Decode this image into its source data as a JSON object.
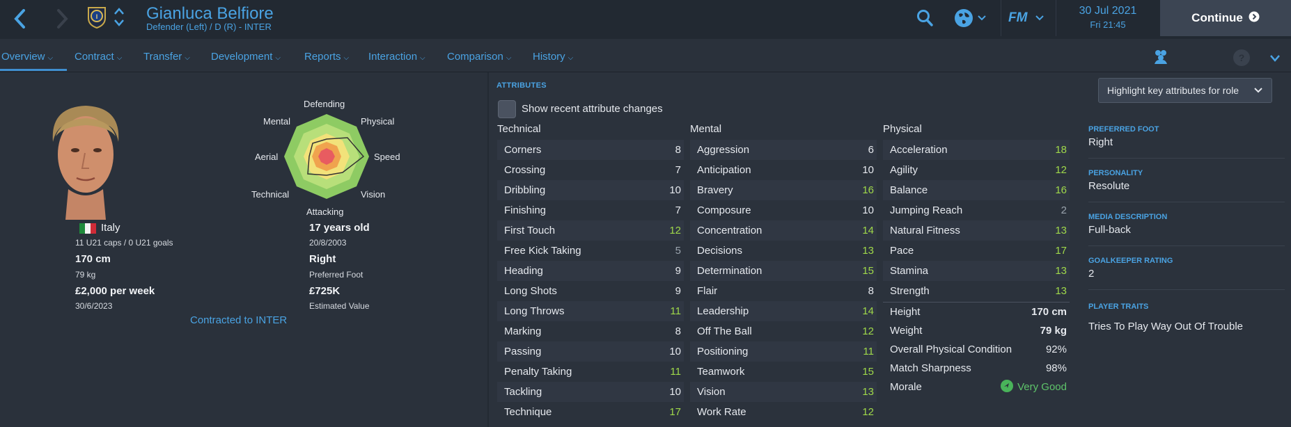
{
  "header": {
    "player_name": "Gianluca Belfiore",
    "player_subtitle": "Defender (Left) / D (R) - INTER",
    "date": "30 Jul 2021",
    "time": "Fri 21:45",
    "continue_label": "Continue",
    "logo_label": "FM"
  },
  "tabs": [
    {
      "label": "Overview"
    },
    {
      "label": "Contract"
    },
    {
      "label": "Transfer"
    },
    {
      "label": "Development"
    },
    {
      "label": "Reports"
    },
    {
      "label": "Interaction"
    },
    {
      "label": "Comparison"
    },
    {
      "label": "History"
    }
  ],
  "profile": {
    "nationality": "Italy",
    "caps": "11 U21 caps / 0 U21 goals",
    "height": "170 cm",
    "weight": "79 kg",
    "wage": "£2,000 per week",
    "contract_end": "30/6/2023",
    "contracted_to": "Contracted to INTER",
    "age": "17 years old",
    "dob": "20/8/2003",
    "preferred_foot": "Right",
    "preferred_foot_label": "Preferred Foot",
    "value": "£725K",
    "value_label": "Estimated Value"
  },
  "radar": {
    "labels": {
      "defending": "Defending",
      "physical": "Physical",
      "speed": "Speed",
      "vision": "Vision",
      "attacking": "Attacking",
      "technical": "Technical",
      "aerial": "Aerial",
      "mental": "Mental"
    }
  },
  "attributes": {
    "title": "ATTRIBUTES",
    "show_changes": "Show recent attribute changes",
    "highlight_label": "Highlight key attributes for role",
    "technical_title": "Technical",
    "mental_title": "Mental",
    "physical_title": "Physical",
    "technical": [
      {
        "name": "Corners",
        "value": "8",
        "tone": "white"
      },
      {
        "name": "Crossing",
        "value": "7",
        "tone": "white"
      },
      {
        "name": "Dribbling",
        "value": "10",
        "tone": "white"
      },
      {
        "name": "Finishing",
        "value": "7",
        "tone": "white"
      },
      {
        "name": "First Touch",
        "value": "12",
        "tone": "green"
      },
      {
        "name": "Free Kick Taking",
        "value": "5",
        "tone": "grey"
      },
      {
        "name": "Heading",
        "value": "9",
        "tone": "white"
      },
      {
        "name": "Long Shots",
        "value": "9",
        "tone": "white"
      },
      {
        "name": "Long Throws",
        "value": "11",
        "tone": "green"
      },
      {
        "name": "Marking",
        "value": "8",
        "tone": "white"
      },
      {
        "name": "Passing",
        "value": "10",
        "tone": "white"
      },
      {
        "name": "Penalty Taking",
        "value": "11",
        "tone": "green"
      },
      {
        "name": "Tackling",
        "value": "10",
        "tone": "white"
      },
      {
        "name": "Technique",
        "value": "17",
        "tone": "green"
      }
    ],
    "mental": [
      {
        "name": "Aggression",
        "value": "6",
        "tone": "white"
      },
      {
        "name": "Anticipation",
        "value": "10",
        "tone": "white"
      },
      {
        "name": "Bravery",
        "value": "16",
        "tone": "green"
      },
      {
        "name": "Composure",
        "value": "10",
        "tone": "white"
      },
      {
        "name": "Concentration",
        "value": "14",
        "tone": "green"
      },
      {
        "name": "Decisions",
        "value": "13",
        "tone": "green"
      },
      {
        "name": "Determination",
        "value": "15",
        "tone": "green"
      },
      {
        "name": "Flair",
        "value": "8",
        "tone": "white"
      },
      {
        "name": "Leadership",
        "value": "14",
        "tone": "green"
      },
      {
        "name": "Off The Ball",
        "value": "12",
        "tone": "green"
      },
      {
        "name": "Positioning",
        "value": "11",
        "tone": "green"
      },
      {
        "name": "Teamwork",
        "value": "15",
        "tone": "green"
      },
      {
        "name": "Vision",
        "value": "13",
        "tone": "green"
      },
      {
        "name": "Work Rate",
        "value": "12",
        "tone": "green"
      }
    ],
    "physical": [
      {
        "name": "Acceleration",
        "value": "18",
        "tone": "green"
      },
      {
        "name": "Agility",
        "value": "12",
        "tone": "green"
      },
      {
        "name": "Balance",
        "value": "16",
        "tone": "green"
      },
      {
        "name": "Jumping Reach",
        "value": "2",
        "tone": "grey"
      },
      {
        "name": "Natural Fitness",
        "value": "13",
        "tone": "green"
      },
      {
        "name": "Pace",
        "value": "17",
        "tone": "green"
      },
      {
        "name": "Stamina",
        "value": "13",
        "tone": "green"
      },
      {
        "name": "Strength",
        "value": "13",
        "tone": "green"
      }
    ],
    "physical_extra": [
      {
        "name": "Height",
        "value": "170 cm"
      },
      {
        "name": "Weight",
        "value": "79 kg"
      },
      {
        "name": "Overall Physical Condition",
        "value": "92%"
      },
      {
        "name": "Match Sharpness",
        "value": "98%"
      },
      {
        "name": "Morale",
        "value": "Very Good"
      }
    ]
  },
  "side_info": {
    "preferred_foot_label": "PREFERRED FOOT",
    "preferred_foot": "Right",
    "personality_label": "PERSONALITY",
    "personality": "Resolute",
    "media_label": "MEDIA DESCRIPTION",
    "media": "Full-back",
    "gk_label": "GOALKEEPER RATING",
    "gk": "2",
    "traits_label": "PLAYER TRAITS",
    "traits": "Tries To Play Way Out Of Trouble"
  },
  "colors": {
    "accent": "#4aa3e3",
    "good": "#9fd84a",
    "morale": "#49b35a"
  }
}
